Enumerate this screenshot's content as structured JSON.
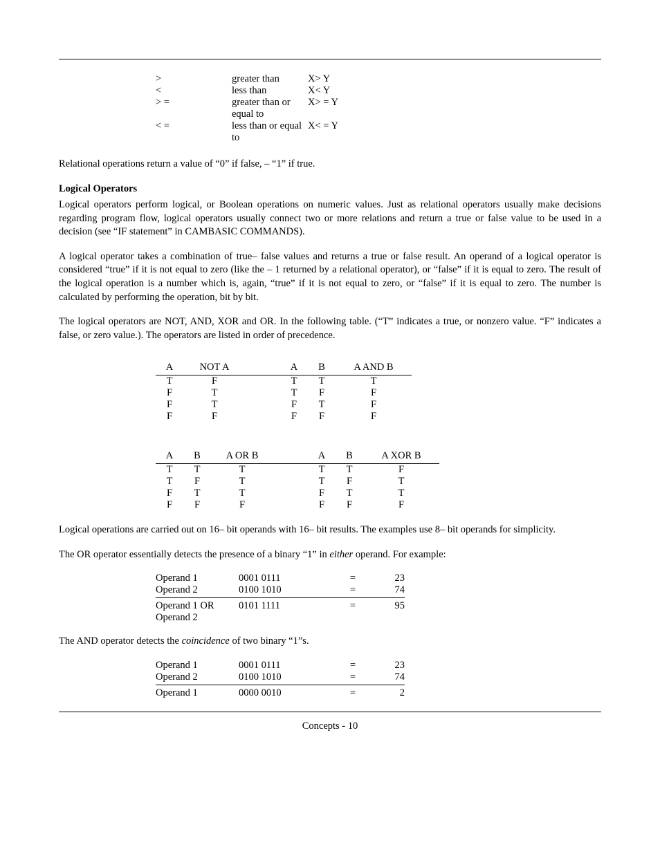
{
  "relational_ops": [
    {
      "sym": ">",
      "desc": "greater than",
      "ex": "X> Y"
    },
    {
      "sym": "<",
      "desc": "less than",
      "ex": "X< Y"
    },
    {
      "sym": "> =",
      "desc": "greater than or equal to",
      "ex": "X> = Y"
    },
    {
      "sym": "< =",
      "desc": "less than or equal to",
      "ex": "X< = Y"
    }
  ],
  "p_relreturn": "Relational operations return a value of “0” if false, –  “1”  if true.",
  "h_logical": "Logical Operators",
  "p_logical1": "Logical operators perform  logical, or Boolean operations on numeric values.  Just as relational operators usually make decisions regarding program flow, logical operators usually connect two or more relations and return a true or false value to be used in a decision (see “IF statement” in CAMBASIC COMMANDS).",
  "p_logical2": "A logical operator takes a combination of true– false values and returns a true or false result.  An operand of a logical operator is considered “true” if it is not equal to zero (like the – 1 returned by a relational operator), or “false” if it is equal to zero.  The result of the logical operation is a number which is, again, “true” if it is not equal to zero, or “false” if it is equal to zero.  The number is calculated by performing the operation, bit by bit.",
  "p_logical3": "The logical operators are NOT, AND, XOR and OR.  In the following table.  (“T” indicates a true, or nonzero value.  “F” indicates a false, or zero value.).  The operators are listed in order of precedence.",
  "truth1_head_l": [
    "A",
    "NOT A"
  ],
  "truth1_head_r": [
    "A",
    "B",
    "A AND B"
  ],
  "truth1_rows": [
    {
      "l": [
        "T",
        "F"
      ],
      "r": [
        "T",
        "T",
        "T"
      ]
    },
    {
      "l": [
        "F",
        "T"
      ],
      "r": [
        "T",
        "F",
        "F"
      ]
    },
    {
      "l": [
        "F",
        "T"
      ],
      "r": [
        "F",
        "T",
        "F"
      ]
    },
    {
      "l": [
        "F",
        "F"
      ],
      "r": [
        "F",
        "F",
        "F"
      ]
    }
  ],
  "truth2_head_l": [
    "A",
    "B",
    "A OR B"
  ],
  "truth2_head_r": [
    "A",
    "B",
    "A XOR B"
  ],
  "truth2_rows": [
    {
      "l": [
        "T",
        "T",
        "T"
      ],
      "r": [
        "T",
        "T",
        "F"
      ]
    },
    {
      "l": [
        "T",
        "F",
        "T"
      ],
      "r": [
        "T",
        "F",
        "T"
      ]
    },
    {
      "l": [
        "F",
        "T",
        "T"
      ],
      "r": [
        "F",
        "T",
        "T"
      ]
    },
    {
      "l": [
        "F",
        "F",
        "F"
      ],
      "r": [
        "F",
        "F",
        "F"
      ]
    }
  ],
  "p_logops16": "Logical operations are carried out on 16– bit operands with 16– bit results.  The examples use 8– bit operands for simplicity.",
  "p_or_a": "The OR operator essentially detects the presence of a binary “1” in ",
  "p_or_em": "either",
  "p_or_b": " operand.  For example:",
  "or_example": {
    "rows": [
      {
        "label": "Operand 1",
        "bin": "0001 0111",
        "eq": "=",
        "dec": "23"
      },
      {
        "label": "Operand 2",
        "bin": "0100 1010",
        "eq": "=",
        "dec": "74"
      }
    ],
    "result": {
      "label": "Operand 1 OR Operand 2",
      "bin": "0101 1111",
      "eq": "=",
      "dec": "95"
    }
  },
  "p_and_a": "The AND  operator detects the ",
  "p_and_em": "coincidence",
  "p_and_b": " of two binary “1”s.",
  "and_example": {
    "rows": [
      {
        "label": "Operand 1",
        "bin": "0001 0111",
        "eq": "=",
        "dec": "23"
      },
      {
        "label": "Operand 2",
        "bin": "0100 1010",
        "eq": "=",
        "dec": "74"
      }
    ],
    "result": {
      "label": "Operand 1",
      "bin": "0000 0010",
      "eq": "=",
      "dec": "2"
    }
  },
  "footer": "Concepts - 10"
}
